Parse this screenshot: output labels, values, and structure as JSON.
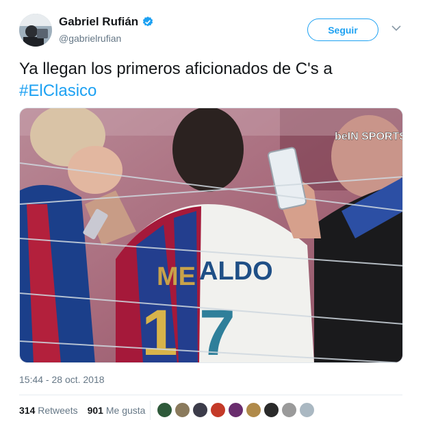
{
  "author": {
    "display_name": "Gabriel Rufián",
    "handle": "@gabrielrufian",
    "verified": true,
    "avatar_icon": "user-avatar"
  },
  "follow_button": {
    "label": "Seguir"
  },
  "menu": {
    "icon": "chevron-down-icon"
  },
  "tweet": {
    "text": "Ya llegan los primeros aficionados de C's a",
    "hashtag": "#ElClasico"
  },
  "media": {
    "watermark": "beIN SPORTS",
    "description_icon": "photo-stadium-fans"
  },
  "timestamp": "15:44 - 28 oct. 2018",
  "stats": {
    "retweets_count": "314",
    "retweets_label": "Retweets",
    "likes_count": "901",
    "likes_label": "Me gusta"
  },
  "likers": [
    {
      "color": "#2e5a3a"
    },
    {
      "color": "#8a7a5c"
    },
    {
      "color": "#3c3c4a"
    },
    {
      "color": "#c43a28"
    },
    {
      "color": "#6a2d6e"
    },
    {
      "color": "#b08a4a"
    },
    {
      "color": "#2a2a2a"
    },
    {
      "color": "#9a9a9a"
    },
    {
      "color": "#aab8c2"
    }
  ],
  "colors": {
    "accent": "#1da1f2",
    "text": "#14171a",
    "secondary_text": "#657786"
  }
}
